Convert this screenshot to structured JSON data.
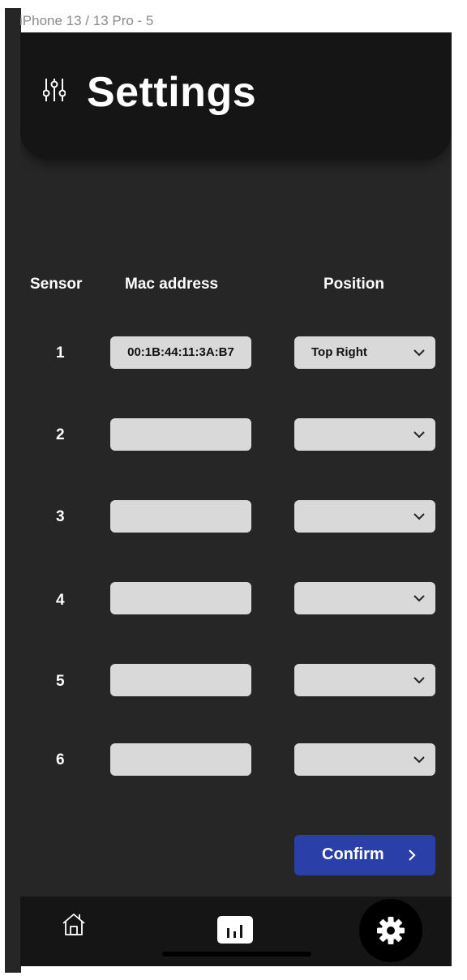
{
  "frame": {
    "label": "iPhone 13 / 13 Pro - 5"
  },
  "header": {
    "title": "Settings",
    "icon": "sliders-icon"
  },
  "table": {
    "columns": {
      "sensor": "Sensor",
      "mac": "Mac address",
      "position": "Position"
    },
    "rows": [
      {
        "sensor": "1",
        "mac": "00:1B:44:11:3A:B7",
        "position": "Top Right"
      },
      {
        "sensor": "2",
        "mac": "",
        "position": ""
      },
      {
        "sensor": "3",
        "mac": "",
        "position": ""
      },
      {
        "sensor": "4",
        "mac": "",
        "position": ""
      },
      {
        "sensor": "5",
        "mac": "",
        "position": ""
      },
      {
        "sensor": "6",
        "mac": "",
        "position": ""
      }
    ]
  },
  "confirm": {
    "label": "Confirm",
    "icon": "chevron-right-icon"
  },
  "nav": {
    "items": [
      {
        "icon": "home-icon",
        "active": false
      },
      {
        "icon": "bar-chart-icon",
        "active": false
      },
      {
        "icon": "gear-icon",
        "active": true
      }
    ]
  },
  "colors": {
    "background": "#262626",
    "header": "#151515",
    "field": "#d9d9d9",
    "accent": "#2a3fa8",
    "text": "#ffffff"
  }
}
